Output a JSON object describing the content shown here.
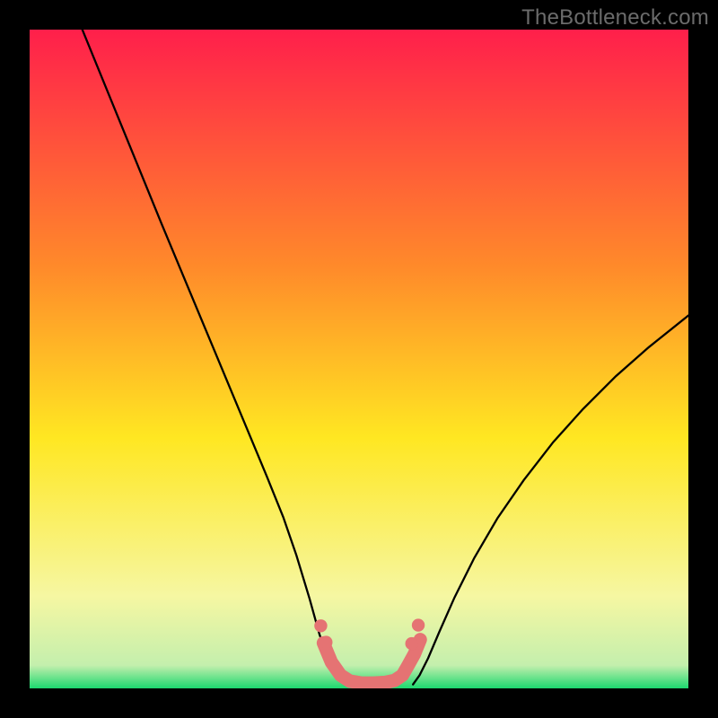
{
  "watermark": "TheBottleneck.com",
  "chart_data": {
    "type": "line",
    "title": "",
    "xlabel": "",
    "ylabel": "",
    "xlim": [
      0,
      100
    ],
    "ylim": [
      0,
      100
    ],
    "gradient_colors": {
      "top": "#ff1f4b",
      "upper_mid": "#ff8a2a",
      "mid": "#ffe722",
      "lower_mid": "#f6f7a2",
      "bottom": "#1cd86f"
    },
    "series": [
      {
        "name": "black-curve-left",
        "color": "#000000",
        "x": [
          8,
          12,
          16,
          20,
          24,
          28,
          32,
          36,
          38.5,
          40.5,
          42.5,
          44.0,
          45.4,
          46.8,
          48.0
        ],
        "y": [
          100,
          90.2,
          80.4,
          70.6,
          61.0,
          51.4,
          41.8,
          32.2,
          26.0,
          20.2,
          13.6,
          8.2,
          4.2,
          1.6,
          0.6
        ]
      },
      {
        "name": "black-curve-right",
        "color": "#000000",
        "x": [
          58.2,
          59.2,
          60.5,
          62.2,
          64.5,
          67.5,
          71.0,
          75.0,
          79.5,
          84.0,
          89.0,
          94.0,
          100.0
        ],
        "y": [
          0.6,
          2.0,
          4.6,
          8.6,
          13.8,
          19.8,
          25.8,
          31.6,
          37.4,
          42.4,
          47.4,
          51.8,
          56.6
        ]
      },
      {
        "name": "salmon-band",
        "color": "#e57373",
        "x": [
          44.6,
          45.8,
          47.2,
          48.6,
          50.4,
          52.2,
          54.0,
          55.4,
          56.6,
          57.4,
          58.4,
          59.3
        ],
        "y": [
          6.9,
          4.0,
          2.0,
          1.1,
          0.8,
          0.8,
          0.9,
          1.2,
          2.0,
          3.4,
          5.2,
          7.4
        ]
      }
    ]
  }
}
